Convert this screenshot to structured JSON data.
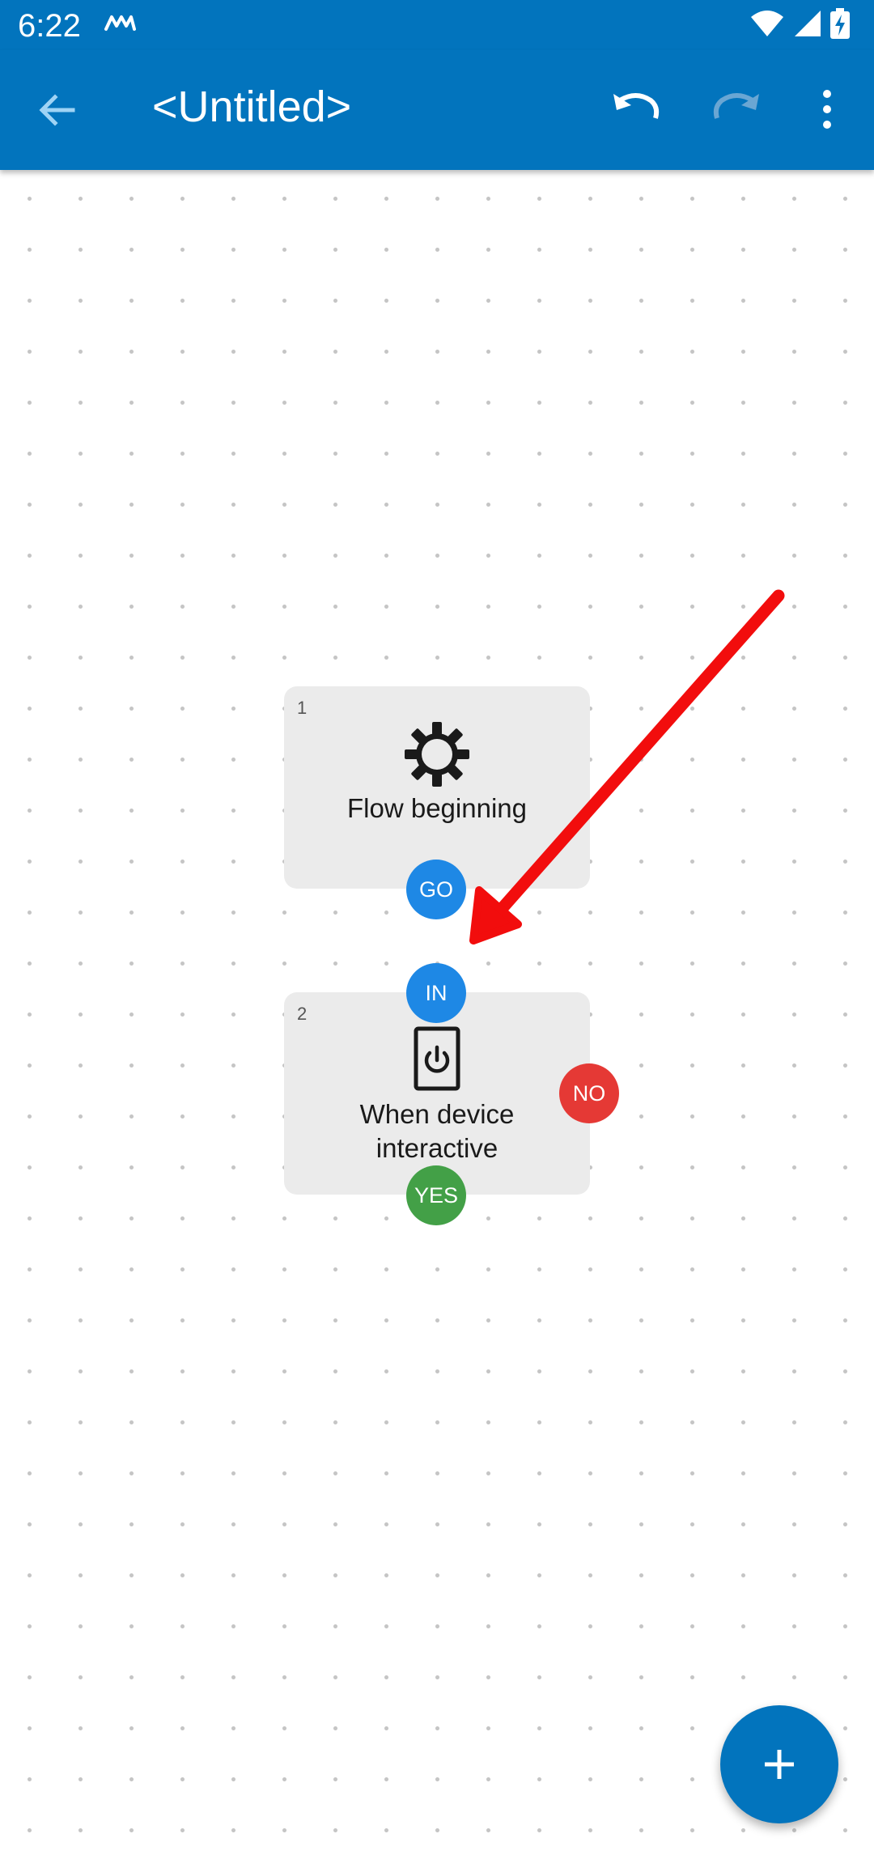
{
  "status_bar": {
    "time": "6:22",
    "icons": [
      "app-notification-icon",
      "wifi-icon",
      "signal-icon",
      "battery-charging-icon"
    ]
  },
  "app_bar": {
    "title": "<Untitled>",
    "icons": [
      "back-arrow-icon",
      "undo-icon",
      "redo-icon",
      "more-vert-icon"
    ]
  },
  "nodes": [
    {
      "number": "1",
      "label": "Flow beginning",
      "icon": "gear-icon",
      "ports": [
        "GO"
      ]
    },
    {
      "number": "2",
      "label_line1": "When device",
      "label_line2": "interactive",
      "icon": "power-device-icon",
      "ports": [
        "IN",
        "NO",
        "YES"
      ]
    }
  ],
  "fab": {
    "icon": "plus-icon"
  },
  "colors": {
    "primary": "#0274bd",
    "port_blue": "#1e88e5",
    "port_red": "#e53935",
    "port_green": "#43a047",
    "arrow": "#f20d0d",
    "node_bg": "#ebebeb"
  }
}
